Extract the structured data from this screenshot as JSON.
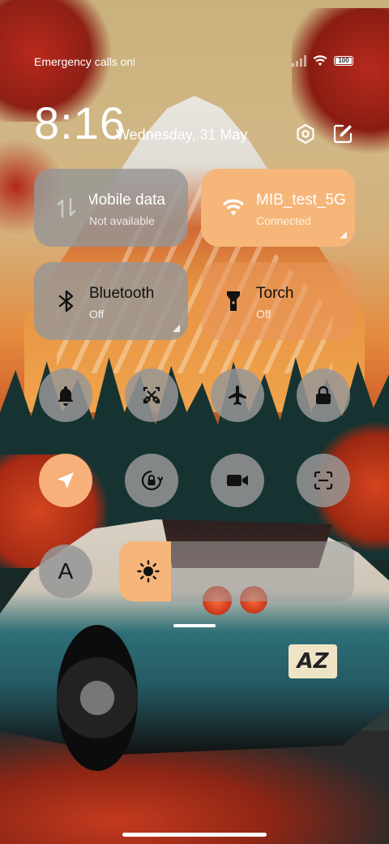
{
  "status_bar": {
    "carrier_text": "Emergency calls only",
    "battery_label": "100",
    "icons": [
      "signal-icon",
      "wifi-icon",
      "battery-icon"
    ]
  },
  "header": {
    "time": "8:16",
    "date": "Wednesday, 31 May",
    "settings_icon": "gear-icon",
    "edit_icon": "edit-icon"
  },
  "tiles": [
    {
      "title": "Mobile data",
      "subtitle": "Not available",
      "icon": "mobile-data-icon",
      "state": "disabled"
    },
    {
      "title": "MIB_test_5G",
      "subtitle": "Connected",
      "icon": "wifi-icon",
      "state": "on"
    },
    {
      "title": "Bluetooth",
      "subtitle": "Off",
      "icon": "bluetooth-icon",
      "state": "off"
    },
    {
      "title": "Torch",
      "subtitle": "Off",
      "icon": "torch-icon",
      "state": "off"
    }
  ],
  "toggles_row1": [
    {
      "icon": "bell-icon",
      "state": "off"
    },
    {
      "icon": "screenshot-icon",
      "state": "off"
    },
    {
      "icon": "airplane-icon",
      "state": "off"
    },
    {
      "icon": "lock-icon",
      "state": "off"
    }
  ],
  "toggles_row2": [
    {
      "icon": "location-icon",
      "state": "on"
    },
    {
      "icon": "rotation-lock-icon",
      "state": "off"
    },
    {
      "icon": "video-camera-icon",
      "state": "off"
    },
    {
      "icon": "scan-icon",
      "state": "off"
    }
  ],
  "auto_brightness_label": "A",
  "brightness": {
    "icon": "sun-icon",
    "level_fraction": 0.22
  },
  "wallpaper_plate_text": "AZ",
  "colors": {
    "accent": "#f6b679",
    "tile_gray": "#969696"
  }
}
